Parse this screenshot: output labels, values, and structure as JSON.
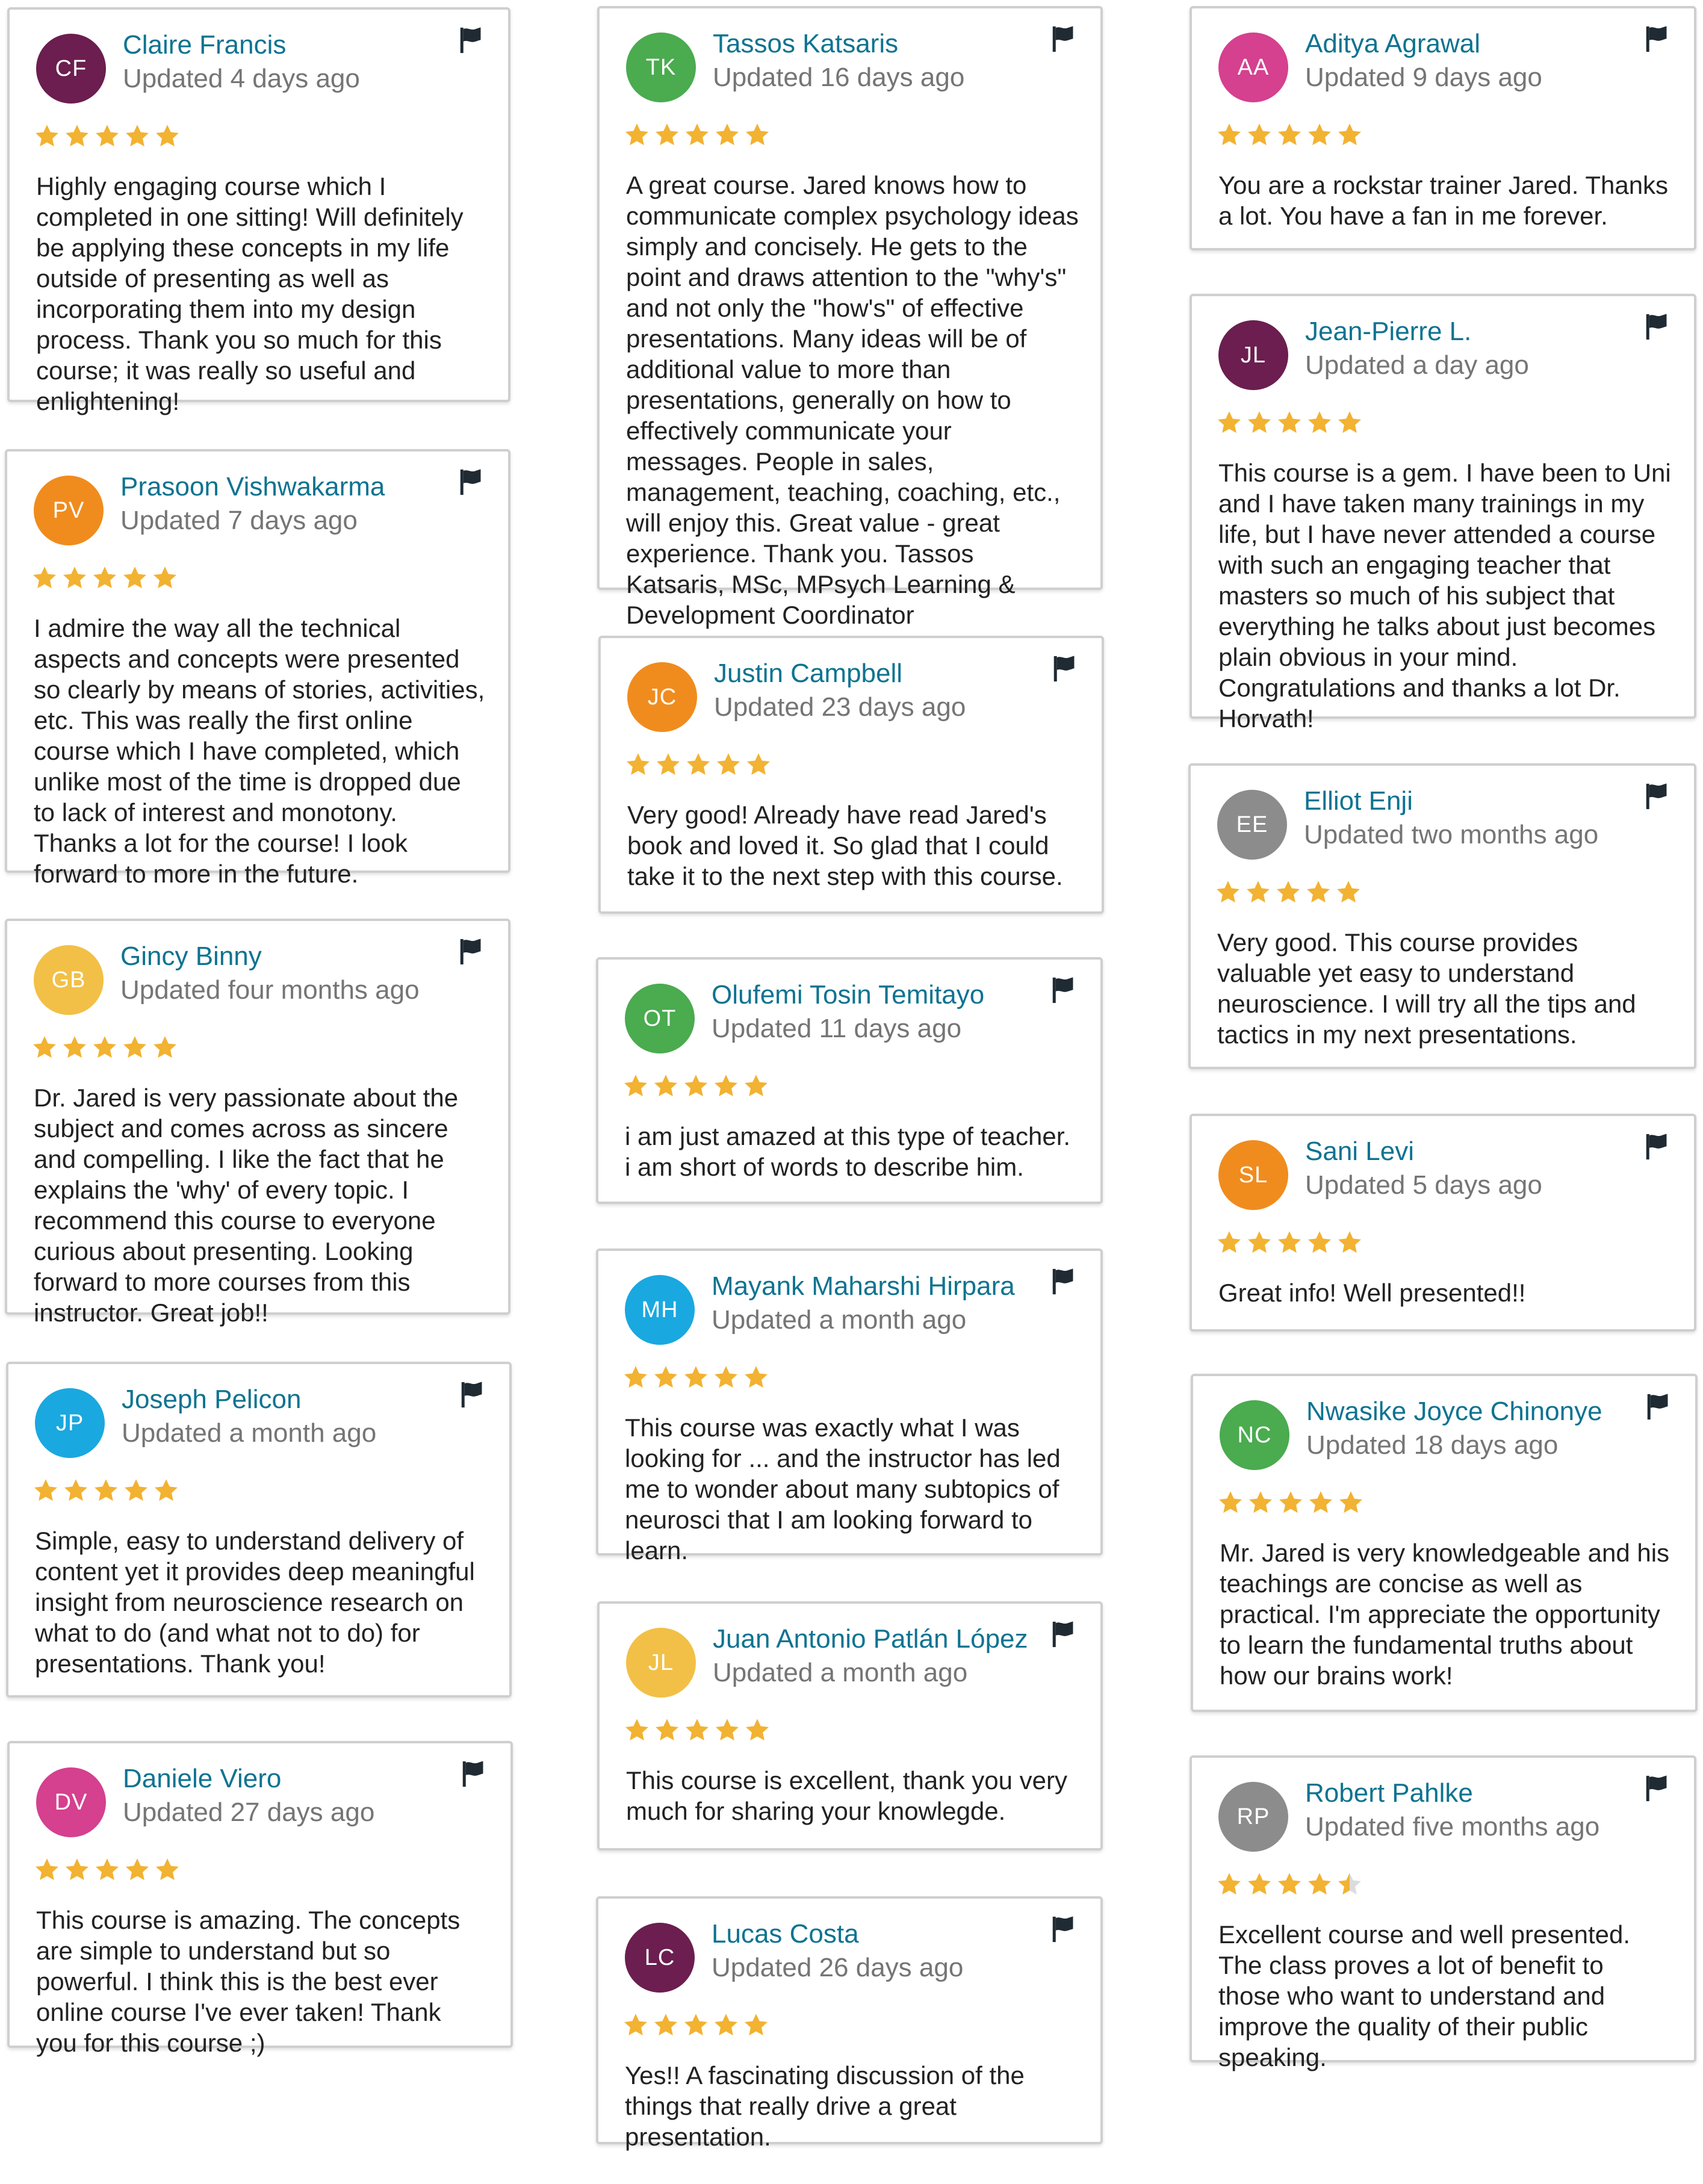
{
  "reviews": [
    {
      "initials": "CF",
      "name": "Claire Francis",
      "updated": "Updated 4 days ago",
      "color": "#6b1e4f",
      "rating": 5,
      "text": "Highly engaging course which I completed in one sitting! Will definitely be applying these concepts in my life outside of presenting as well as incorporating them into my design process. Thank you so much for this course; it was really so useful and enlightening!"
    },
    {
      "initials": "PV",
      "name": "Prasoon Vishwakarma",
      "updated": "Updated 7 days ago",
      "color": "#f08c1e",
      "rating": 5,
      "text": "I admire the way all the technical aspects and concepts were presented so clearly by means of stories, activities, etc. This was really the first online course which I have completed, which unlike most of the time is dropped due to lack of interest and monotony. Thanks a lot for the course! I look forward to more in the future."
    },
    {
      "initials": "GB",
      "name": "Gincy Binny",
      "updated": "Updated four months ago",
      "color": "#f2c046",
      "rating": 5,
      "text": "Dr. Jared is very passionate about the subject and comes across as sincere and compelling. I like the fact that he explains the 'why' of every topic. I recommend this course to everyone curious about presenting. Looking forward to more courses from this instructor. Great job!!"
    },
    {
      "initials": "JP",
      "name": "Joseph Pelicon",
      "updated": "Updated a month ago",
      "color": "#1aa8e0",
      "rating": 5,
      "text": "Simple, easy to understand delivery of content yet it provides deep meaningful insight from neuroscience research on what to do (and what not to do) for presentations. Thank you!"
    },
    {
      "initials": "DV",
      "name": "Daniele Viero",
      "updated": "Updated 27 days ago",
      "color": "#d5408f",
      "rating": 5,
      "text": "This course is amazing. The concepts are simple to understand but so powerful. I think this is the best ever online course I've ever taken! Thank you for this course ;)"
    },
    {
      "initials": "TK",
      "name": "Tassos Katsaris",
      "updated": "Updated 16 days ago",
      "color": "#4aab4f",
      "rating": 5,
      "text": "A great course. Jared knows how to communicate complex psychology ideas simply and concisely. He gets to the point and draws attention to the \"why's\" and not only the \"how's\" of effective presentations. Many ideas will be of additional value to more than presentations, generally on how to effectively communicate your messages. People in sales, management, teaching, coaching, etc., will enjoy this. Great value - great experience. Thank you. Tassos Katsaris, MSc, MPsych Learning & Development Coordinator"
    },
    {
      "initials": "JC",
      "name": "Justin Campbell",
      "updated": "Updated 23 days ago",
      "color": "#f08c1e",
      "rating": 5,
      "text": "Very good! Already have read Jared's book and loved it. So glad that I could take it to the next step with this course."
    },
    {
      "initials": "OT",
      "name": "Olufemi Tosin Temitayo",
      "updated": "Updated 11 days ago",
      "color": "#4aab4f",
      "rating": 5,
      "text": "i am just amazed at this type of teacher. i am short of words to describe him."
    },
    {
      "initials": "MH",
      "name": "Mayank Maharshi Hirpara",
      "updated": "Updated a month ago",
      "color": "#1aa8e0",
      "rating": 5,
      "text": "This course was exactly what I was looking for ... and the instructor has led me to wonder about many subtopics of neurosci that I am looking forward to learn."
    },
    {
      "initials": "JL",
      "name": "Juan Antonio Patlán López",
      "updated": "Updated a month ago",
      "color": "#f2c046",
      "rating": 5,
      "text": "This course is excellent, thank you very much for sharing your knowlegde."
    },
    {
      "initials": "LC",
      "name": "Lucas Costa",
      "updated": "Updated 26 days ago",
      "color": "#6b1e4f",
      "rating": 5,
      "text": "Yes!! A fascinating discussion of the things that really drive a great presentation."
    },
    {
      "initials": "AA",
      "name": "Aditya Agrawal",
      "updated": "Updated 9 days ago",
      "color": "#d5408f",
      "rating": 5,
      "text": "You are a rockstar trainer Jared. Thanks a lot.  You have a fan in me forever."
    },
    {
      "initials": "JL",
      "name": "Jean-Pierre L.",
      "updated": "Updated a day ago",
      "color": "#6b1e4f",
      "rating": 5,
      "text": "This course is a gem. I have been to Uni and I have taken many trainings in my life, but I have never attended a course with such an engaging teacher that masters so much of his subject that everything he talks about just becomes plain obvious in your mind. Congratulations and thanks a lot Dr. Horvath!"
    },
    {
      "initials": "EE",
      "name": "Elliot Enji",
      "updated": "Updated two months ago",
      "color": "#8c8c8c",
      "rating": 5,
      "text": "Very good. This course provides valuable yet easy to understand neuroscience. I will try all the tips and tactics in my next presentations."
    },
    {
      "initials": "SL",
      "name": "Sani Levi",
      "updated": "Updated 5 days ago",
      "color": "#f08c1e",
      "rating": 5,
      "text": "Great info! Well presented!!"
    },
    {
      "initials": "NC",
      "name": "Nwasike Joyce Chinonye",
      "updated": "Updated 18 days ago",
      "color": "#4aab4f",
      "rating": 5,
      "text": "Mr. Jared is very knowledgeable and his teachings are concise as well as practical. I'm appreciate the opportunity to learn the fundamental truths about how our brains work!"
    },
    {
      "initials": "RP",
      "name": "Robert Pahlke",
      "updated": "Updated five months ago",
      "color": "#8c8c8c",
      "rating": 4.5,
      "text": "Excellent course and well presented. The class proves a lot of benefit to those who want to understand and improve the quality of  their public speaking."
    }
  ]
}
